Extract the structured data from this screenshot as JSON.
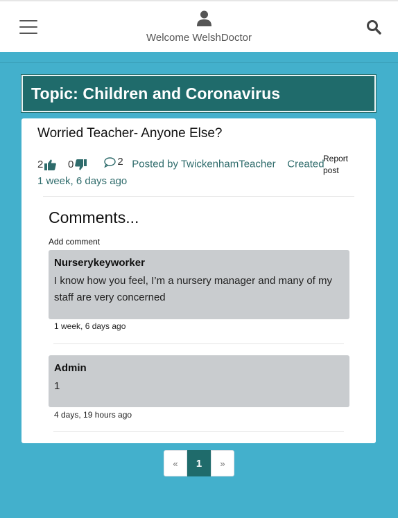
{
  "header": {
    "welcome": "Welcome WelshDoctor"
  },
  "topic": {
    "title": "Topic: Children and Coronavirus"
  },
  "post": {
    "title": "Worried Teacher- Anyone Else?",
    "likes": "2",
    "dislikes": "0",
    "comment_count": "2",
    "posted_by": "Posted by TwickenhamTeacher",
    "created_label": "Created",
    "created_ago": "1 week, 6 days ago",
    "report_label": "Report post"
  },
  "comments": {
    "heading": "Comments...",
    "add_label": "Add comment",
    "items": [
      {
        "author": "Nurserykeyworker",
        "text": "I know how you feel, I’m a nursery manager and many of my staff are very concerned",
        "time": "1 week, 6 days ago"
      },
      {
        "author": "Admin",
        "text": "1",
        "time": "4 days, 19 hours ago"
      }
    ]
  },
  "pagination": {
    "prev": "«",
    "current": "1",
    "next": "»"
  },
  "colors": {
    "background": "#43b0cc",
    "accent": "#1f6b6b",
    "comment_bg": "#c9cccf"
  },
  "icons": [
    "menu-icon",
    "user-icon",
    "search-icon",
    "thumbs-up-icon",
    "thumbs-down-icon",
    "comment-icon"
  ]
}
